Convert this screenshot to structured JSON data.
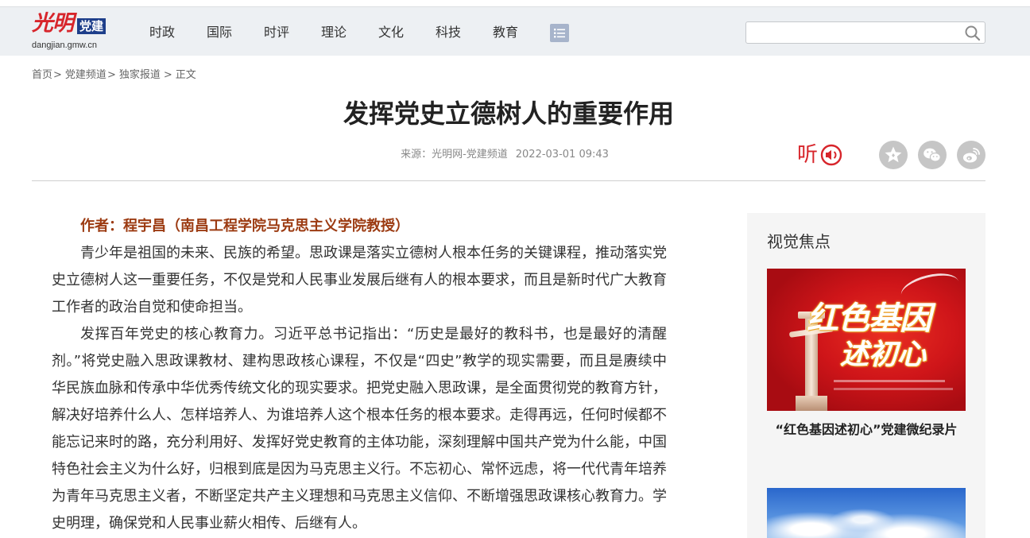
{
  "colors": {
    "accent": "#d7252b",
    "author": "#9c3b12",
    "header_bg": "#edf0f3",
    "badge": "#1d3e8a"
  },
  "header": {
    "logo": {
      "brand": "光明",
      "badge": "党建",
      "domain": "dangjian.gmw.cn"
    },
    "nav": [
      {
        "label": "时政"
      },
      {
        "label": "国际"
      },
      {
        "label": "时评"
      },
      {
        "label": "理论"
      },
      {
        "label": "文化"
      },
      {
        "label": "科技"
      },
      {
        "label": "教育"
      }
    ],
    "menu_icon": "list-icon",
    "search": {
      "icon": "search-icon"
    }
  },
  "breadcrumb": {
    "items": [
      "首页",
      "党建频道",
      "独家报道",
      "正文"
    ],
    "separator": ">"
  },
  "article": {
    "title": "发挥党史立德树人的重要作用",
    "source": "来源：光明网-党建频道",
    "datetime": "2022-03-01 09:43",
    "listen_label": "听",
    "listen_icon": "audio-icon",
    "share_icons": [
      "star-icon",
      "wechat-icon",
      "weibo-icon"
    ],
    "author": "作者：程宇昌（南昌工程学院马克思主义学院教授）",
    "paragraphs": [
      "青少年是祖国的未来、民族的希望。思政课是落实立德树人根本任务的关键课程，推动落实党史立德树人这一重要任务，不仅是党和人民事业发展后继有人的根本要求，而且是新时代广大教育工作者的政治自觉和使命担当。",
      "发挥百年党史的核心教育力。习近平总书记指出：“历史是最好的教科书，也是最好的清醒剂。”将党史融入思政课教材、建构思政核心课程，不仅是“四史”教学的现实需要，而且是赓续中华民族血脉和传承中华优秀传统文化的现实要求。把党史融入思政课，是全面贯彻党的教育方针，解决好培养什么人、怎样培养人、为谁培养人这个根本任务的根本要求。走得再远，任何时候都不能忘记来时的路，充分利用好、发挥好党史教育的主体功能，深刻理解中国共产党为什么能，中国特色社会主义为什么好，归根到底是因为马克思主义行。不忘初心、常怀远虑，将一代代青年培养为青年马克思主义者，不断坚定共产主义理想和马克思主义信仰、不断增强思政课核心教育力。学史明理，确保党和人民事业薪火相传、后继有人。"
    ]
  },
  "sidebar": {
    "title": "视觉焦点",
    "items": [
      {
        "caption": "“红色基因述初心”党建微纪录片",
        "image_text": {
          "line1": "红色基因",
          "line2": "述初心"
        }
      }
    ]
  }
}
